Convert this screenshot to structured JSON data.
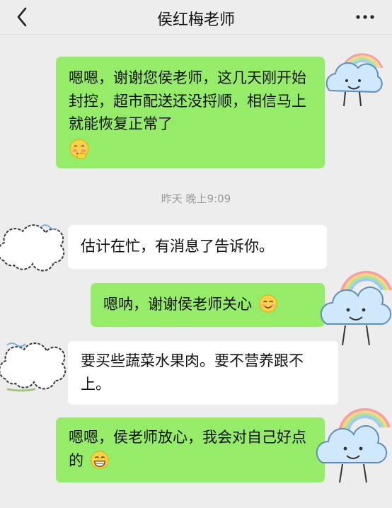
{
  "header": {
    "title": "侯红梅老师"
  },
  "messages": [
    {
      "side": "right",
      "type": "text",
      "text": "嗯嗯，谢谢您侯老师，这几天刚开始封控，超市配送还没捋顺，相信马上就能恢复正常了",
      "emoji": "blush-emoji"
    },
    {
      "timestamp": "昨天 晚上9:09"
    },
    {
      "side": "left",
      "type": "text",
      "text": "估计在忙，有消息了告诉你。"
    },
    {
      "side": "right",
      "type": "text",
      "text": "嗯呐，谢谢侯老师关心",
      "emoji": "smile-emoji"
    },
    {
      "side": "left",
      "type": "text",
      "text": "要买些蔬菜水果肉。要不营养跟不上。"
    },
    {
      "side": "right",
      "type": "text",
      "text": "嗯嗯，侯老师放心，我会对自己好点的",
      "emoji": "grin-emoji"
    }
  ],
  "colors": {
    "green_bubble": "#95ec69",
    "white_bubble": "#ffffff",
    "background": "#ededed",
    "cloud_blue": "#cfe8fb"
  },
  "icons": {
    "back": "chevron-left-icon",
    "more": "more-dots-icon",
    "self_avatar": "cloud-rainbow-avatar",
    "other_avatar": "cloud-outline-avatar"
  }
}
